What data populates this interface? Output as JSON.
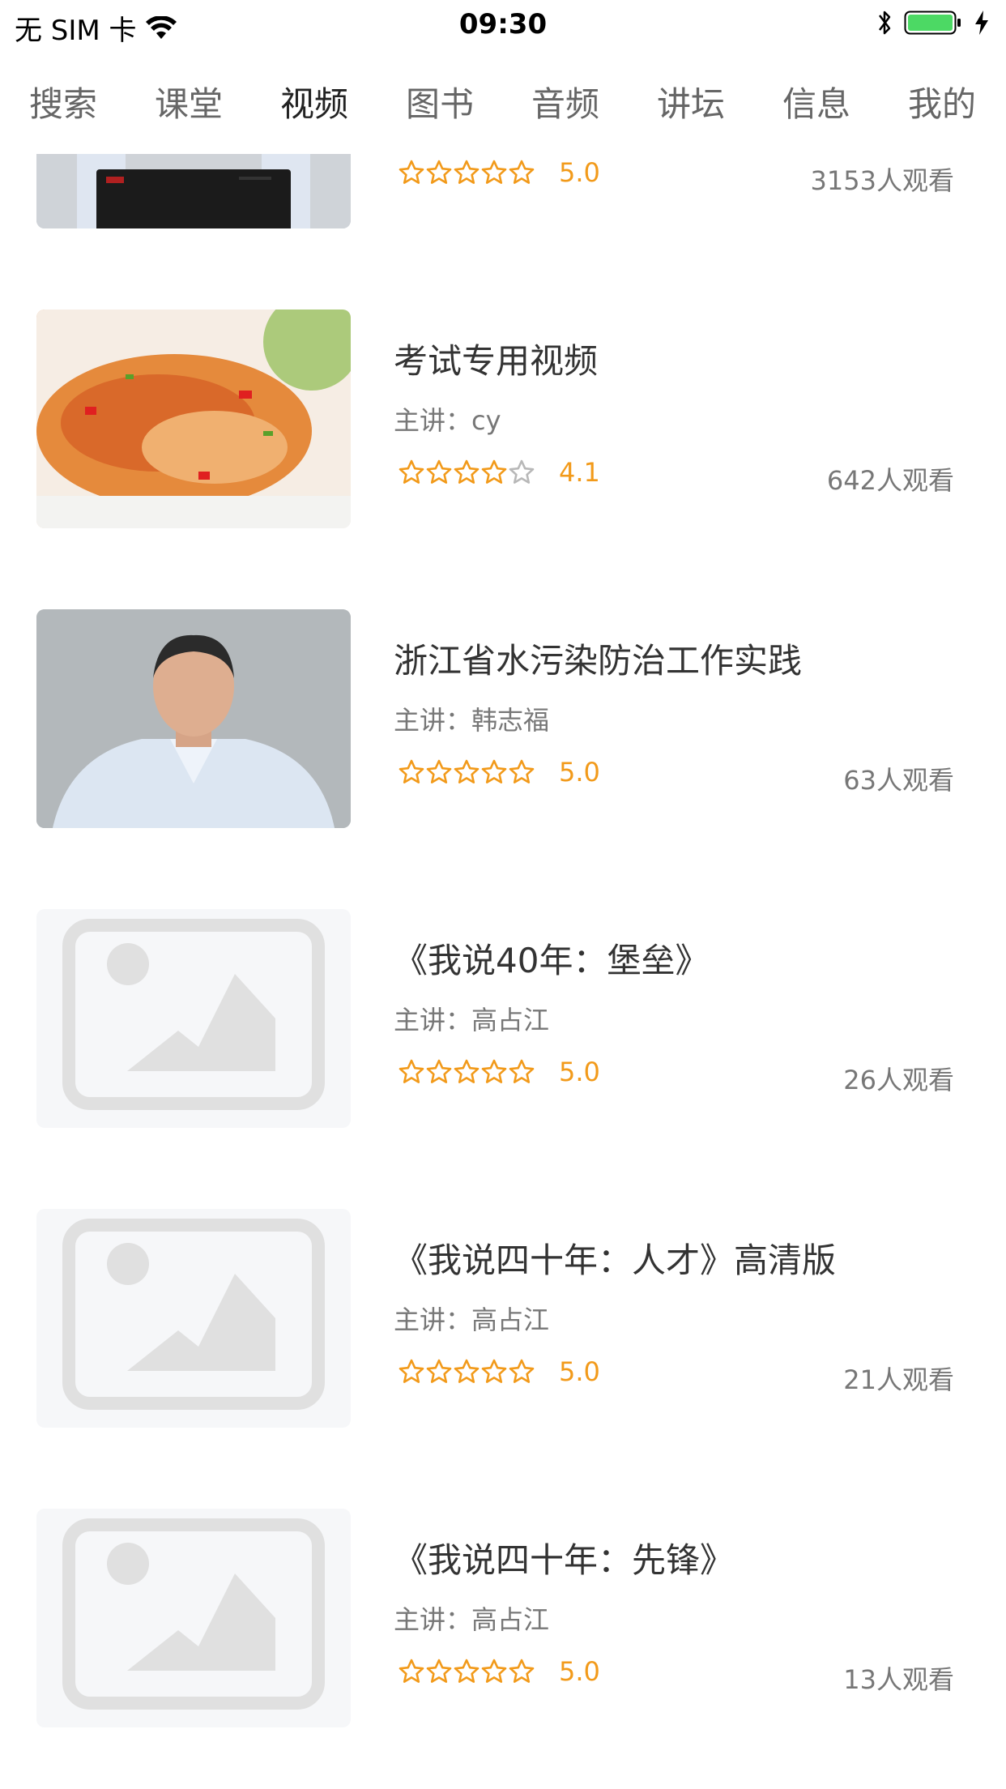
{
  "status_bar": {
    "carrier": "无 SIM 卡",
    "time": "09:30",
    "wifi_icon": "wifi-icon",
    "bluetooth_icon": "bluetooth-icon",
    "battery_icon": "battery-icon",
    "charging_icon": "charging-bolt-icon",
    "battery_color": "#4cd964"
  },
  "tabs": [
    {
      "label": "搜索"
    },
    {
      "label": "课堂"
    },
    {
      "label": "视频",
      "active": true
    },
    {
      "label": "图书"
    },
    {
      "label": "音频"
    },
    {
      "label": "讲坛"
    },
    {
      "label": "信息"
    },
    {
      "label": "我的"
    }
  ],
  "colors": {
    "accent_star": "#f29a1a",
    "text_primary": "#333333",
    "text_secondary": "#777777"
  },
  "videos": [
    {
      "title": "",
      "lecturer": "",
      "rating": 5.0,
      "score_label": "5.0",
      "views": "3153人观看",
      "thumbnail": "lecture-laptop"
    },
    {
      "title": "考试专用视频",
      "lecturer": "主讲：cy",
      "rating": 4.1,
      "score_label": "4.1",
      "views": "642人观看",
      "thumbnail": "food-photo"
    },
    {
      "title": "浙江省水污染防治工作实践",
      "lecturer": "主讲：韩志福",
      "rating": 5.0,
      "score_label": "5.0",
      "views": "63人观看",
      "thumbnail": "speaker-photo"
    },
    {
      "title": "《我说40年：堡垒》",
      "lecturer": "主讲：高占江",
      "rating": 5.0,
      "score_label": "5.0",
      "views": "26人观看",
      "thumbnail": "placeholder-image-icon"
    },
    {
      "title": "《我说四十年：人才》高清版",
      "lecturer": "主讲：高占江",
      "rating": 5.0,
      "score_label": "5.0",
      "views": "21人观看",
      "thumbnail": "placeholder-image-icon"
    },
    {
      "title": "《我说四十年：先锋》",
      "lecturer": "主讲：高占江",
      "rating": 5.0,
      "score_label": "5.0",
      "views": "13人观看",
      "thumbnail": "placeholder-image-icon"
    }
  ]
}
